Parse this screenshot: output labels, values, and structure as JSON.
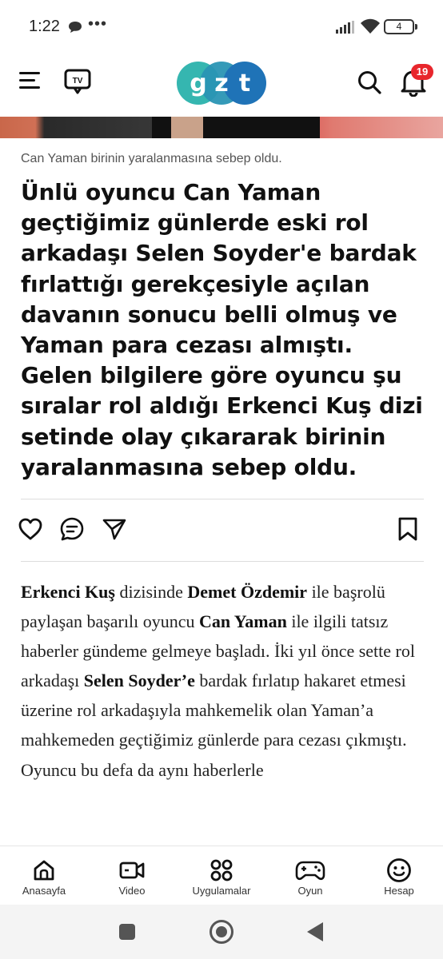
{
  "status_bar": {
    "time": "1:22",
    "dots": "•••",
    "battery": "4"
  },
  "header": {
    "logo_text": "gzt",
    "notification_count": "19",
    "colors": {
      "logo_teal": "#35b6b0",
      "logo_blue": "#1f73b7",
      "badge_red": "#e8262c"
    }
  },
  "article": {
    "caption": "Can Yaman birinin yaralanmasına sebep oldu.",
    "headline": "Ünlü oyuncu Can Yaman geçtiğimiz günlerde eski rol arkadaşı Selen Soyder'e bardak fırlattığı gerekçesiyle açılan davanın sonucu belli olmuş ve Yaman para cezası almıştı. Gelen bilgilere göre oyuncu şu sıralar rol aldığı Erkenci Kuş dizi setinde olay çıkararak birinin yaralanmasına sebep oldu.",
    "actions": {
      "like": "heart-icon",
      "comment": "comment-icon",
      "share": "send-icon",
      "bookmark": "bookmark-icon"
    },
    "body": {
      "b1": "Erkenci Kuş",
      "t1": " dizisinde ",
      "b2": "Demet Özdemir",
      "t2": " ile başrolü paylaşan başarılı oyuncu ",
      "b3": "Can Yaman",
      "t3": " ile ilgili tatsız haberler gündeme gelmeye başladı. İki yıl önce sette rol arkadaşı ",
      "b4": "Selen Soyder’e",
      "t4": " bardak fırlatıp hakaret etmesi üzerine rol arkadaşıyla mahkemelik olan Yaman’a mahkemeden geçtiğimiz günlerde para cezası çıkmıştı. Oyuncu bu defa da aynı haberlerle"
    }
  },
  "bottom_nav": [
    {
      "label": "Anasayfa",
      "icon": "home-icon"
    },
    {
      "label": "Video",
      "icon": "video-icon"
    },
    {
      "label": "Uygulamalar",
      "icon": "apps-icon"
    },
    {
      "label": "Oyun",
      "icon": "gamepad-icon"
    },
    {
      "label": "Hesap",
      "icon": "smiley-icon"
    }
  ]
}
